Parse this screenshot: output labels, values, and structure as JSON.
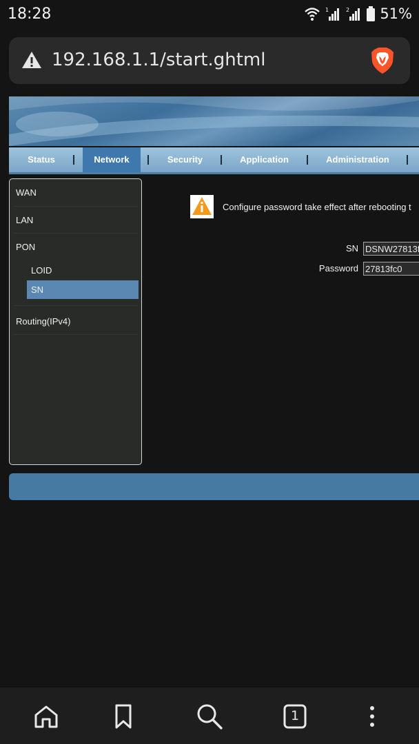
{
  "status_bar": {
    "time": "18:28",
    "battery": "51%",
    "icons": [
      "wifi-icon",
      "signal-1-icon",
      "signal-2-icon",
      "battery-icon"
    ]
  },
  "browser": {
    "url": "192.168.1.1/start.ghtml",
    "left_icon": "warning-icon",
    "right_icon": "brave-lion-icon",
    "tab_count": "1"
  },
  "nav": {
    "items": [
      "Status",
      "Network",
      "Security",
      "Application",
      "Administration"
    ],
    "active": "Network"
  },
  "sidebar": {
    "items": [
      {
        "label": "WAN"
      },
      {
        "label": "LAN"
      },
      {
        "label": "PON",
        "children": [
          {
            "label": "LOID"
          },
          {
            "label": "SN",
            "active": true
          }
        ]
      },
      {
        "label": "Routing(IPv4)"
      }
    ]
  },
  "content": {
    "notice": "Configure password take effect after rebooting t",
    "fields": [
      {
        "label": "SN",
        "value": "DSNW27813f"
      },
      {
        "label": "Password",
        "value": "27813fc0"
      }
    ]
  },
  "colors": {
    "accent": "#467aa3",
    "active_tab": "#3f78ad",
    "sidebar_active": "#5a88b3",
    "brave": "#fb542b"
  }
}
